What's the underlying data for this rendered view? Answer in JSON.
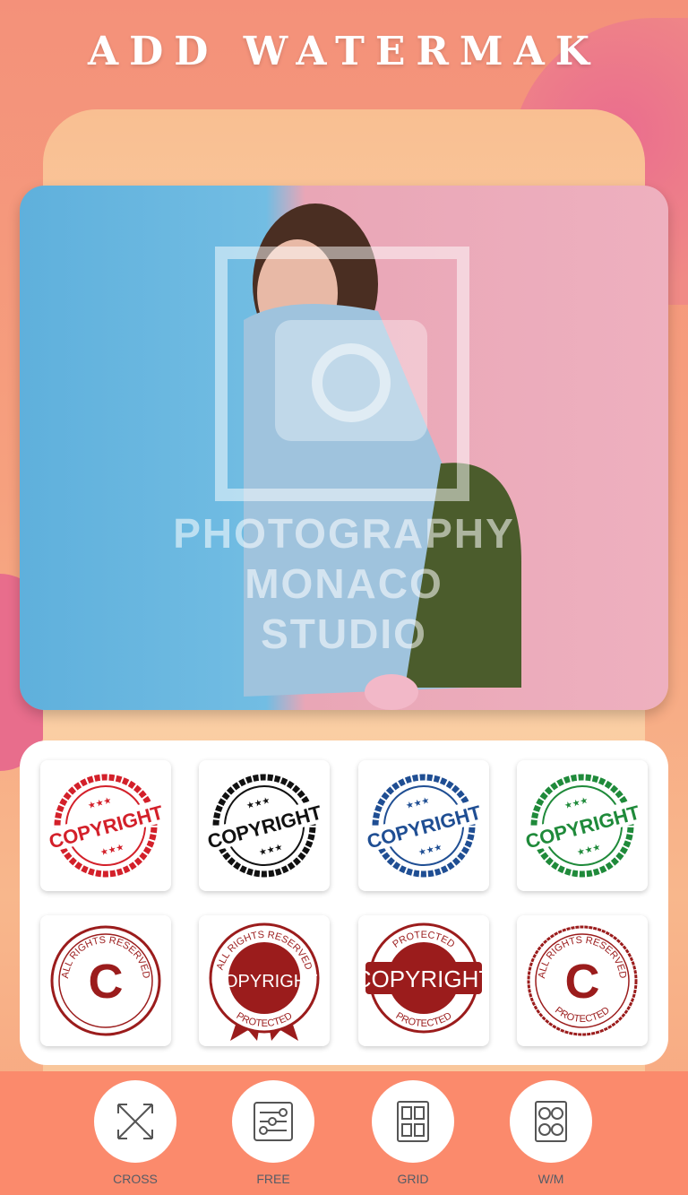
{
  "title": "ADD WATERMAK",
  "photo": {
    "watermark_lines": [
      "PHOTOGRAPHY",
      "MONACO",
      "STUDIO"
    ]
  },
  "stamps": [
    {
      "style": "round",
      "color": "#d3202a",
      "text": "COPYRIGHT"
    },
    {
      "style": "round",
      "color": "#111111",
      "text": "COPYRIGHT"
    },
    {
      "style": "round",
      "color": "#1f4e93",
      "text": "COPYRIGHT"
    },
    {
      "style": "round",
      "color": "#1f8a3a",
      "text": "COPYRIGHT"
    },
    {
      "style": "c-seal",
      "color": "#9b1c1c",
      "top": "ALL RIGHTS RESERVED",
      "bottom": ""
    },
    {
      "style": "ribbon",
      "color": "#9b1c1c",
      "top": "ALL RIGHTS RESERVED",
      "text": "COPYRIGHT",
      "bottom": "PROTECTED"
    },
    {
      "style": "banner",
      "color": "#9b1c1c",
      "top": "PROTECTED",
      "text": "COPYRIGHT",
      "bottom": "PROTECTED"
    },
    {
      "style": "c-ring",
      "color": "#9b1c1c",
      "top": "ALL RIGHTS RESERVED",
      "bottom": "PROTECTED"
    }
  ],
  "toolbar": [
    {
      "label": "CROSS",
      "icon": "cross-arrows-icon"
    },
    {
      "label": "FREE",
      "icon": "sliders-icon"
    },
    {
      "label": "GRID",
      "icon": "grid-icon"
    },
    {
      "label": "W/M",
      "icon": "circles-grid-icon"
    }
  ]
}
